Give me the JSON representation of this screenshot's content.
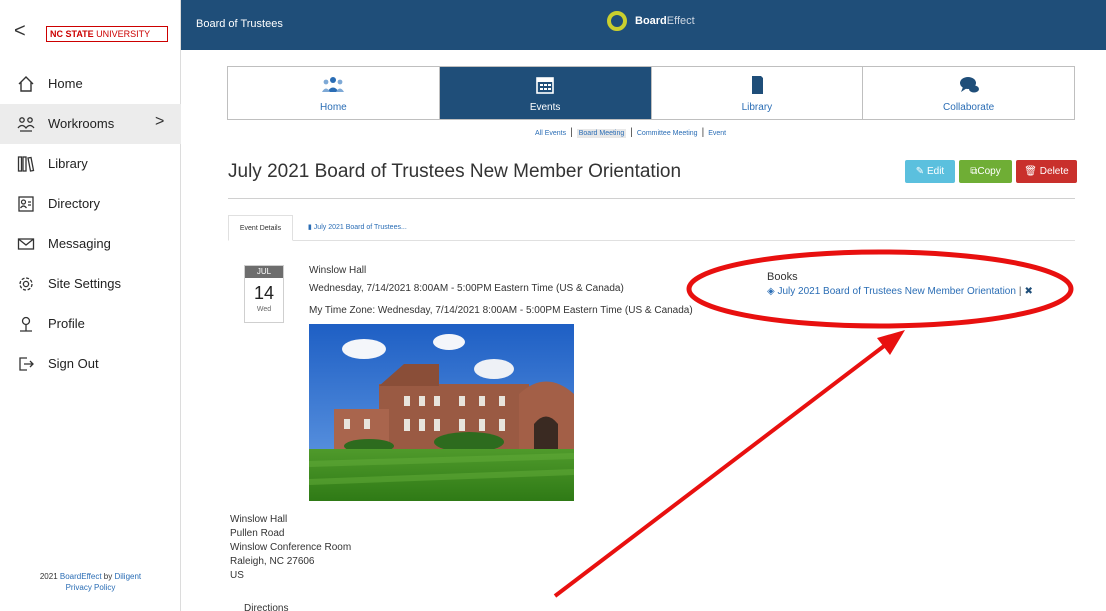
{
  "sidebar": {
    "back_label": "<",
    "logo_bold": "NC STATE",
    "logo_thin": " UNIVERSITY",
    "items": [
      {
        "label": "Home",
        "icon": "home-icon"
      },
      {
        "label": "Workrooms",
        "icon": "workrooms-icon",
        "chevron": ">"
      },
      {
        "label": "Library",
        "icon": "library-icon"
      },
      {
        "label": "Directory",
        "icon": "directory-icon"
      },
      {
        "label": "Messaging",
        "icon": "mail-icon"
      },
      {
        "label": "Site Settings",
        "icon": "gear-icon"
      },
      {
        "label": "Profile",
        "icon": "person-icon"
      },
      {
        "label": "Sign Out",
        "icon": "signout-icon"
      }
    ],
    "footer_prefix": "2021 ",
    "footer_brand": "BoardEffect",
    "footer_by": " by ",
    "footer_company": "Diligent",
    "footer_privacy": "Privacy Policy"
  },
  "header": {
    "title": "Board of Trustees",
    "brand_bold": "Board",
    "brand_light": "Effect"
  },
  "module_tabs": [
    {
      "label": "Home",
      "icon": "people-icon"
    },
    {
      "label": "Events",
      "icon": "calendar-icon"
    },
    {
      "label": "Library",
      "icon": "book-icon"
    },
    {
      "label": "Collaborate",
      "icon": "chat-icon"
    }
  ],
  "subnav": {
    "all": "All Events",
    "board": "Board Meeting",
    "committee": "Committee Meeting",
    "event": "Event"
  },
  "page": {
    "title": "July 2021 Board of Trustees New Member Orientation",
    "edit": "Edit",
    "copy": "Copy",
    "delete": "Delete"
  },
  "content_tabs": {
    "details": "Event Details",
    "book": "July 2021 Board of Trustees..."
  },
  "event": {
    "month": "JUL",
    "day": "14",
    "weekday": "Wed",
    "location_name": "Winslow Hall",
    "time": "Wednesday, 7/14/2021 8:00AM - 5:00PM Eastern Time (US & Canada)",
    "my_time": "My Time Zone: Wednesday, 7/14/2021 8:00AM - 5:00PM Eastern Time (US & Canada)"
  },
  "books": {
    "heading": "Books",
    "link": "July 2021 Board of Trustees New Member Orientation",
    "separator": "|"
  },
  "address": {
    "line1": "Winslow Hall",
    "line2": "Pullen Road",
    "line3": "Winslow Conference Room",
    "line4": "Raleigh, NC 27606",
    "line5": "US"
  },
  "directions_label": "Directions",
  "colors": {
    "header": "#1f4e79",
    "link": "#2a6db5",
    "edit": "#5bc0de",
    "copy": "#6fae35",
    "delete": "#c9302c",
    "annotation": "#e8100f"
  }
}
